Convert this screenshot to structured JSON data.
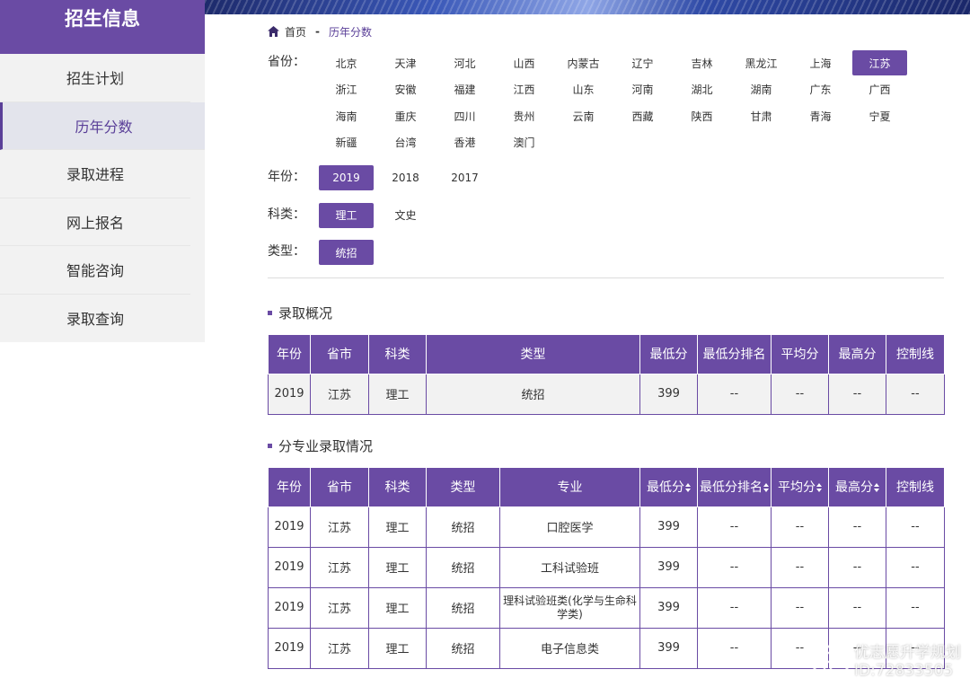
{
  "sidebar": {
    "title": "招生信息",
    "items": [
      {
        "label": "招生计划"
      },
      {
        "label": "历年分数"
      },
      {
        "label": "录取进程"
      },
      {
        "label": "网上报名"
      },
      {
        "label": "智能咨询"
      },
      {
        "label": "录取查询"
      }
    ],
    "active_index": 1
  },
  "breadcrumb": {
    "home": "首页",
    "separator": "-",
    "current": "历年分数"
  },
  "filters": {
    "province_label": "省份：",
    "provinces": [
      "北京",
      "天津",
      "河北",
      "山西",
      "内蒙古",
      "辽宁",
      "吉林",
      "黑龙江",
      "上海",
      "江苏",
      "浙江",
      "安徽",
      "福建",
      "江西",
      "山东",
      "河南",
      "湖北",
      "湖南",
      "广东",
      "广西",
      "海南",
      "重庆",
      "四川",
      "贵州",
      "云南",
      "西藏",
      "陕西",
      "甘肃",
      "青海",
      "宁夏",
      "新疆",
      "台湾",
      "香港",
      "澳门"
    ],
    "province_selected": "江苏",
    "year_label": "年份：",
    "years": [
      "2019",
      "2018",
      "2017"
    ],
    "year_selected": "2019",
    "subject_label": "科类：",
    "subjects": [
      "理工",
      "文史"
    ],
    "subject_selected": "理工",
    "type_label": "类型：",
    "types": [
      "统招"
    ],
    "type_selected": "统招"
  },
  "overview": {
    "title": "录取概况",
    "headers": [
      "年份",
      "省市",
      "科类",
      "类型",
      "最低分",
      "最低分排名",
      "平均分",
      "最高分",
      "控制线"
    ],
    "rows": [
      [
        "2019",
        "江苏",
        "理工",
        "统招",
        "399",
        "--",
        "--",
        "--",
        "--"
      ]
    ]
  },
  "majors": {
    "title": "分专业录取情况",
    "headers": [
      "年份",
      "省市",
      "科类",
      "类型",
      "专业",
      "最低分",
      "最低分排名",
      "平均分",
      "最高分",
      "控制线"
    ],
    "sortable": [
      false,
      false,
      false,
      false,
      false,
      true,
      true,
      true,
      true,
      false
    ],
    "rows": [
      [
        "2019",
        "江苏",
        "理工",
        "统招",
        "口腔医学",
        "399",
        "--",
        "--",
        "--",
        "--"
      ],
      [
        "2019",
        "江苏",
        "理工",
        "统招",
        "工科试验班",
        "399",
        "--",
        "--",
        "--",
        "--"
      ],
      [
        "2019",
        "江苏",
        "理工",
        "统招",
        "理科试验班类(化学与生命科学类)",
        "399",
        "--",
        "--",
        "--",
        "--"
      ],
      [
        "2019",
        "江苏",
        "理工",
        "统招",
        "电子信息类",
        "399",
        "--",
        "--",
        "--",
        "--"
      ]
    ]
  },
  "watermark": {
    "line1": "优志愿升学规划",
    "line2": "ID:72833505"
  },
  "colors": {
    "accent": "#6a4ba4",
    "accent_dark": "#5a3f98",
    "sidebar_bg": "#f2f2f2",
    "active_bg": "#e3e4ec"
  }
}
